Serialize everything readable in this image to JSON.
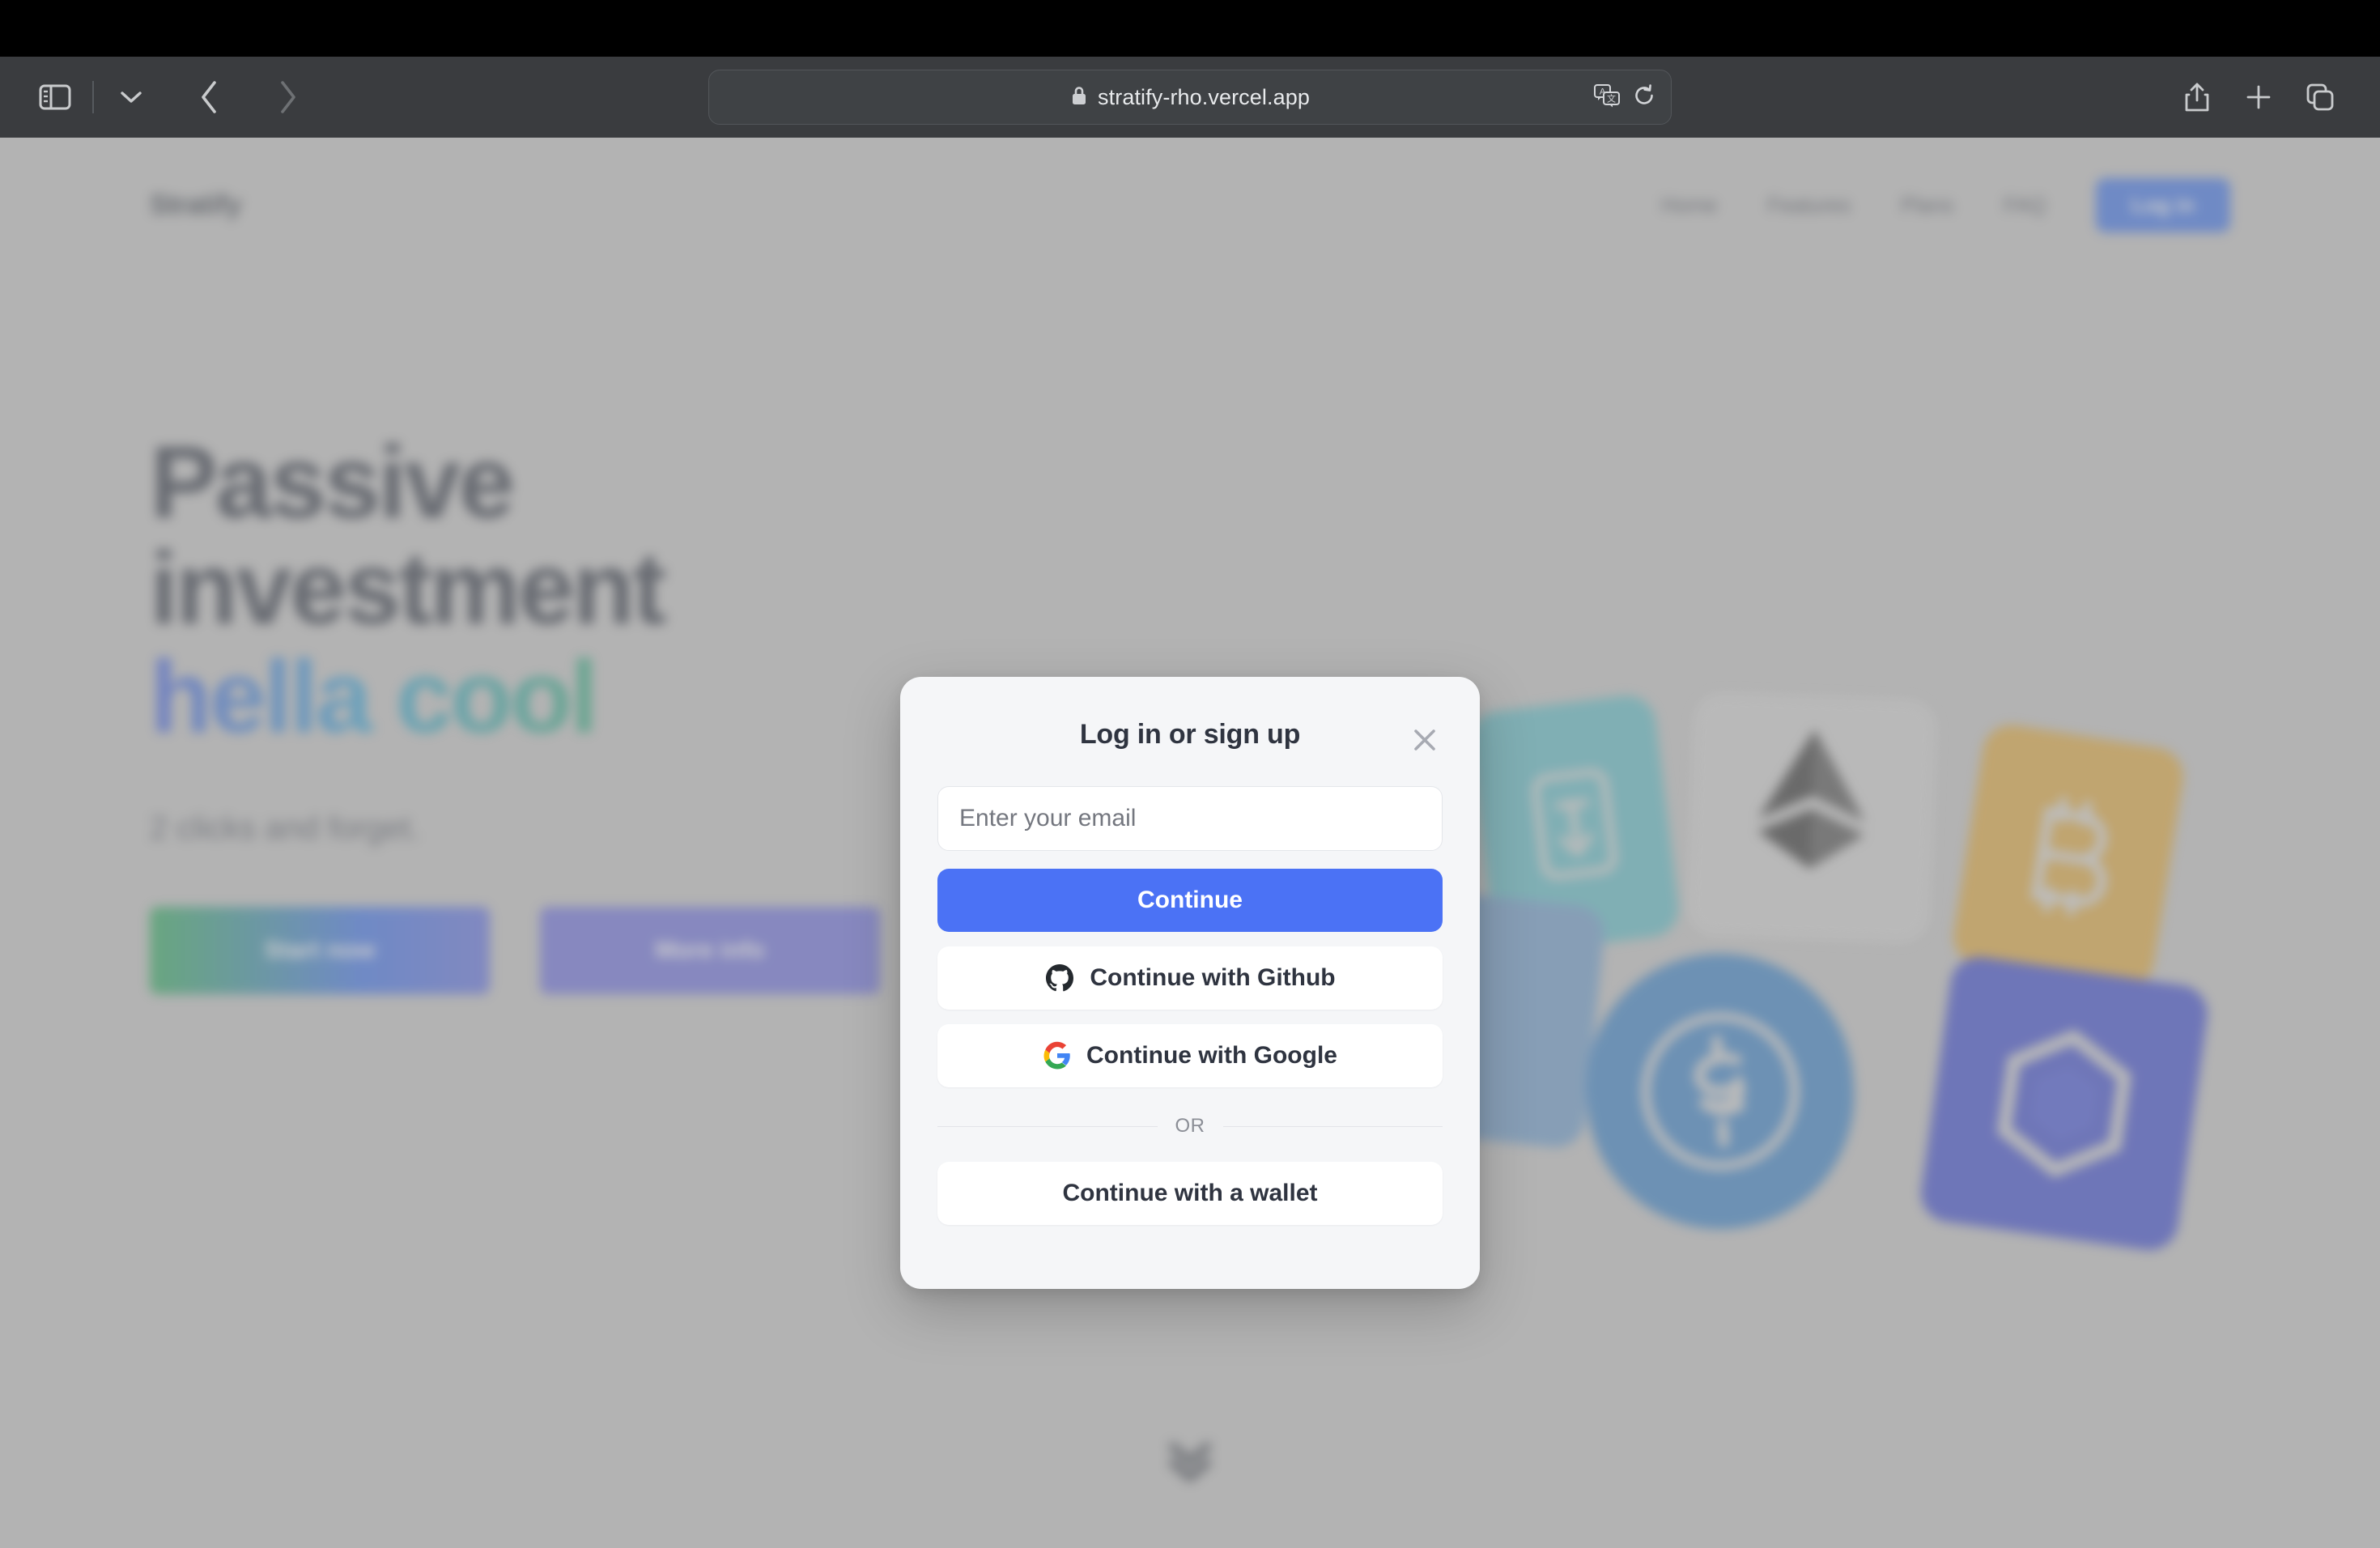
{
  "browser": {
    "sidebar_icon": "sidebar-toggle-icon",
    "tab_dropdown_icon": "chevron-down-icon",
    "back_icon": "back-arrow-icon",
    "forward_icon": "forward-arrow-icon",
    "url": "stratify-rho.vercel.app",
    "lock_icon": "lock-icon",
    "translate_icon": "translate-icon",
    "reload_icon": "reload-icon",
    "share_icon": "share-icon",
    "new_tab_icon": "plus-icon",
    "tab_overview_icon": "tab-overview-icon",
    "chrome_bg": "#3a3c3f",
    "url_field_bg": "#3f4245"
  },
  "site": {
    "logo": "Stratify",
    "nav": [
      {
        "label": "Home"
      },
      {
        "label": "Features"
      },
      {
        "label": "Plans"
      },
      {
        "label": "FAQ"
      }
    ],
    "login_button": "Log in",
    "login_button_color": "#2563eb",
    "hero": {
      "title_line1": "Passive",
      "title_line2": "investment",
      "title_accent": "hella cool",
      "accent_gradient": "#2f4fdd → #17a34a → #5a5ce0",
      "subtitle": "2 clicks and forget.",
      "cta_primary": "Start now",
      "cta_secondary": "More info",
      "cta_primary_gradient": "#16a34a → #2563eb",
      "cta_secondary_color": "#5b5fdd"
    },
    "coins": [
      {
        "name": "tether-icon",
        "color": "#4cb8c4"
      },
      {
        "name": "ethereum-icon",
        "color": "#1f1f1f"
      },
      {
        "name": "bitcoin-icon",
        "color": "#e0a126"
      },
      {
        "name": "usdc-icon",
        "color": "#1f73c4"
      },
      {
        "name": "chainlink-icon",
        "color": "#2334cc"
      },
      {
        "name": "generic-coin-icon",
        "color": "#5b92c9"
      }
    ],
    "scroll_indicator_icon": "chevron-down-icon",
    "page_bg": "#c0c0c0"
  },
  "modal": {
    "title": "Log in or sign up",
    "close_icon": "close-icon",
    "email_placeholder": "Enter your email",
    "email_value": "",
    "continue_label": "Continue",
    "continue_color": "#4b72f5",
    "github_label": "Continue with Github",
    "github_icon": "github-icon",
    "google_label": "Continue with Google",
    "google_icon": "google-icon",
    "divider_label": "OR",
    "wallet_label": "Continue with a wallet",
    "surface_color": "#f5f6f8"
  }
}
